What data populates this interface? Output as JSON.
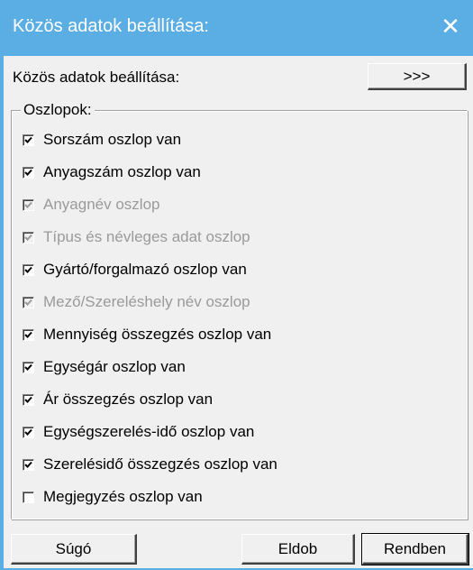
{
  "window": {
    "title": "Közös adatok beállítása:",
    "close_symbol": "✕"
  },
  "top": {
    "label": "Közös adatok beállítása:",
    "more_button": ">>>"
  },
  "group": {
    "legend": "Oszlopok:",
    "items": [
      {
        "label": "Sorszám oszlop van",
        "checked": true,
        "enabled": true
      },
      {
        "label": "Anyagszám oszlop van",
        "checked": true,
        "enabled": true
      },
      {
        "label": "Anyagnév oszlop",
        "checked": true,
        "enabled": false
      },
      {
        "label": "Típus és névleges adat oszlop",
        "checked": true,
        "enabled": false
      },
      {
        "label": "Gyártó/forgalmazó oszlop van",
        "checked": true,
        "enabled": true
      },
      {
        "label": "Mező/Szereléshely név oszlop",
        "checked": true,
        "enabled": false
      },
      {
        "label": "Mennyiség összegzés oszlop van",
        "checked": true,
        "enabled": true
      },
      {
        "label": "Egységár oszlop van",
        "checked": true,
        "enabled": true
      },
      {
        "label": "Ár összegzés oszlop van",
        "checked": true,
        "enabled": true
      },
      {
        "label": "Egységszerelés-idő oszlop van",
        "checked": true,
        "enabled": true
      },
      {
        "label": "Szerelésidő összegzés oszlop van",
        "checked": true,
        "enabled": true
      },
      {
        "label": "Megjegyzés oszlop van",
        "checked": false,
        "enabled": true
      }
    ]
  },
  "buttons": {
    "help": "Súgó",
    "discard": "Eldob",
    "ok": "Rendben"
  }
}
